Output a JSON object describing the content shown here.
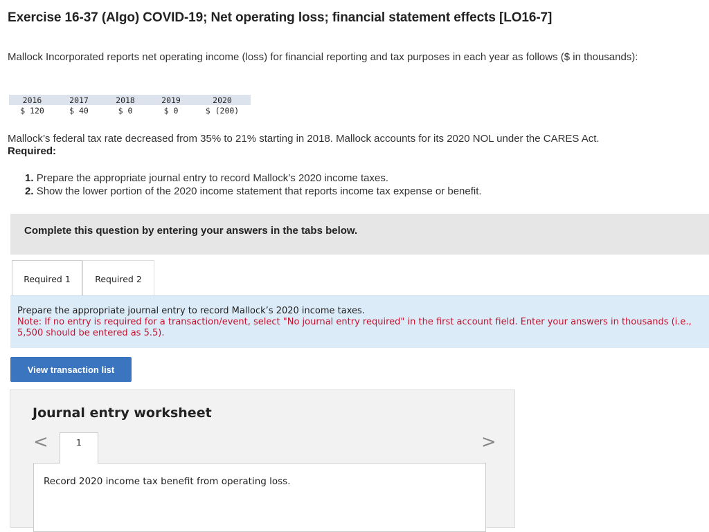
{
  "header": {
    "title": "Exercise 16-37 (Algo) COVID-19; Net operating loss; financial statement effects [LO16-7]"
  },
  "problem": {
    "intro": "Mallock Incorporated reports net operating income (loss) for financial reporting and tax purposes in each year as follows ($ in thousands):",
    "table": {
      "years": [
        "2016",
        "2017",
        "2018",
        "2019",
        "2020"
      ],
      "values": [
        "$ 120",
        "$ 40",
        "$ 0",
        "$ 0",
        "$ (200)"
      ]
    },
    "rate_text": "Mallock’s federal tax rate decreased from 35% to 21% starting in 2018. Mallock accounts for its 2020 NOL under the CARES Act.",
    "required_heading": "Required:",
    "requirements": [
      {
        "num": "1.",
        "text": "Prepare the appropriate journal entry to record Mallock’s 2020 income taxes."
      },
      {
        "num": "2.",
        "text": "Show the lower portion of the 2020 income statement that reports income tax expense or benefit."
      }
    ]
  },
  "complete_bar": {
    "text": "Complete this question by entering your answers in the tabs below."
  },
  "tabs": [
    {
      "label": "Required 1",
      "active": true
    },
    {
      "label": "Required 2",
      "active": false
    }
  ],
  "instructions": {
    "main": "Prepare the appropriate journal entry to record Mallock’s 2020 income taxes.",
    "note": "Note: If no entry is required for a transaction/event, select \"No journal entry required\" in the first account field. Enter your answers in thousands (i.e., 5,500 should be entered as 5.5)."
  },
  "view_button": {
    "label": "View transaction list"
  },
  "worksheet": {
    "title": "Journal entry worksheet",
    "prev_glyph": "<",
    "next_glyph": ">",
    "step": "1",
    "description": "Record 2020 income tax benefit from operating loss."
  }
}
